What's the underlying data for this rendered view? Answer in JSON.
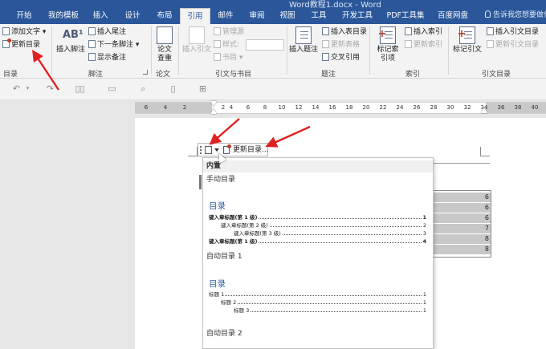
{
  "window": {
    "title": "Word教程1.docx - Word"
  },
  "tabs": [
    {
      "label": "开始",
      "active": false
    },
    {
      "label": "我的模板",
      "active": false
    },
    {
      "label": "插入",
      "active": false
    },
    {
      "label": "设计",
      "active": false
    },
    {
      "label": "布局",
      "active": false
    },
    {
      "label": "引用",
      "active": true
    },
    {
      "label": "邮件",
      "active": false
    },
    {
      "label": "审阅",
      "active": false
    },
    {
      "label": "视图",
      "active": false
    },
    {
      "label": "工具",
      "active": false
    },
    {
      "label": "开发工具",
      "active": false
    },
    {
      "label": "PDF工具集",
      "active": false
    },
    {
      "label": "百度网盘",
      "active": false
    }
  ],
  "tell_me": "告诉我您想要做什么",
  "ribbon": {
    "toc_group": {
      "add_text": "添加文字",
      "update_toc": "更新目录",
      "label": "目录"
    },
    "footnote_group": {
      "insert_footnote": "插入脚注",
      "insert_endnote": "插入尾注",
      "next_footnote": "下一条脚注",
      "show_notes": "显示备注",
      "label": "脚注"
    },
    "research_group": {
      "smart_lookup": "论文查重",
      "label": "论文"
    },
    "citations_group": {
      "insert_citation": "插入引文",
      "manage_sources": "管理源",
      "style": "样式:",
      "bibliography": "书目",
      "label": "引文与书目"
    },
    "captions_group": {
      "insert_caption": "插入题注",
      "insert_table_of_figures": "插入表目录",
      "update_table": "更新表格",
      "cross_reference": "交叉引用",
      "label": "题注"
    },
    "index_group": {
      "mark_entry": "标记索引项",
      "insert_index": "插入索引",
      "update_index": "更新索引",
      "label": "索引"
    },
    "authorities_group": {
      "mark_citation": "标记引文",
      "insert_table_of_authorities": "插入引文目录",
      "update_table": "更新引文目录",
      "label": "引文目录"
    }
  },
  "ruler": {
    "ticks": [
      "6",
      "4",
      "2",
      "2",
      "4",
      "6",
      "8",
      "10",
      "12",
      "14",
      "16",
      "18",
      "20",
      "22",
      "24",
      "26",
      "28",
      "30",
      "32",
      "34",
      "36",
      "38",
      "40"
    ]
  },
  "document": {
    "page_numbers": [
      "6",
      "6",
      "6",
      "7",
      "8",
      "8"
    ]
  },
  "toc_toolbar": {
    "update_label": "更新目录..."
  },
  "gallery": {
    "section_builtin": "内置",
    "manual": {
      "name": "手动目录",
      "title": "目录",
      "lines": [
        {
          "text": "键入章标题(第 1 级)",
          "page": "1",
          "level": 1
        },
        {
          "text": "键入章标题(第 2 级)",
          "page": "2",
          "level": 2
        },
        {
          "text": "键入章标题(第 3 级)",
          "page": "3",
          "level": 3
        },
        {
          "text": "键入章标题(第 1 级)",
          "page": "4",
          "level": 1
        }
      ]
    },
    "auto1": {
      "name": "自动目录 1",
      "title": "目录",
      "lines": [
        {
          "text": "标题 1",
          "page": "1",
          "level": 1
        },
        {
          "text": "标题 2",
          "page": "1",
          "level": 2
        },
        {
          "text": "标题 3",
          "page": "1",
          "level": 3
        }
      ]
    },
    "auto2": {
      "name": "自动目录 2"
    }
  },
  "colors": {
    "accent": "#2b579a",
    "heading_blue": "#2e5f9e",
    "annotation_red": "#e02020"
  }
}
